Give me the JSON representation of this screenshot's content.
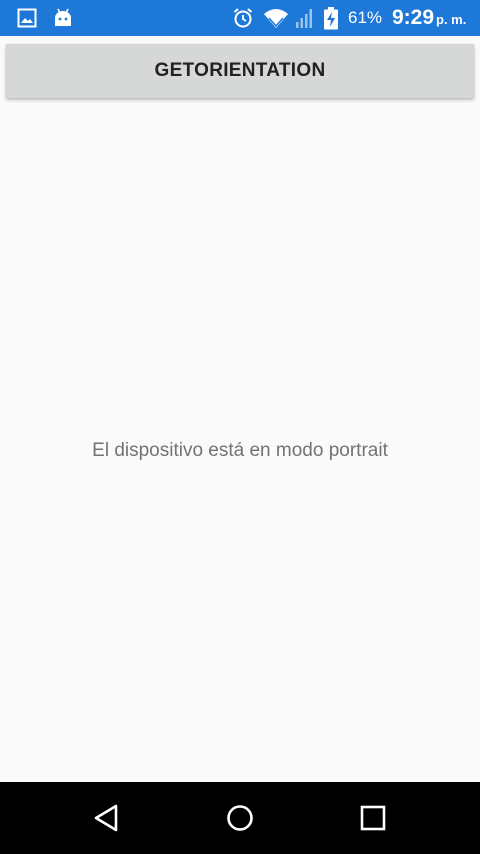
{
  "status_bar": {
    "background": "#1E78D8",
    "left_icons": [
      "image-icon",
      "android-icon"
    ],
    "right_icons": [
      "alarm-icon",
      "wifi-icon",
      "signal-icon",
      "battery-charging-icon"
    ],
    "battery_percent": "61%",
    "time": "9:29",
    "ampm": "p. m."
  },
  "button": {
    "label": "GETORIENTATION",
    "background": "#D6D7D7"
  },
  "message": "El dispositivo está en modo portrait",
  "nav_bar": {
    "background": "#000000",
    "buttons": [
      "back-icon",
      "home-icon",
      "recents-icon"
    ]
  }
}
